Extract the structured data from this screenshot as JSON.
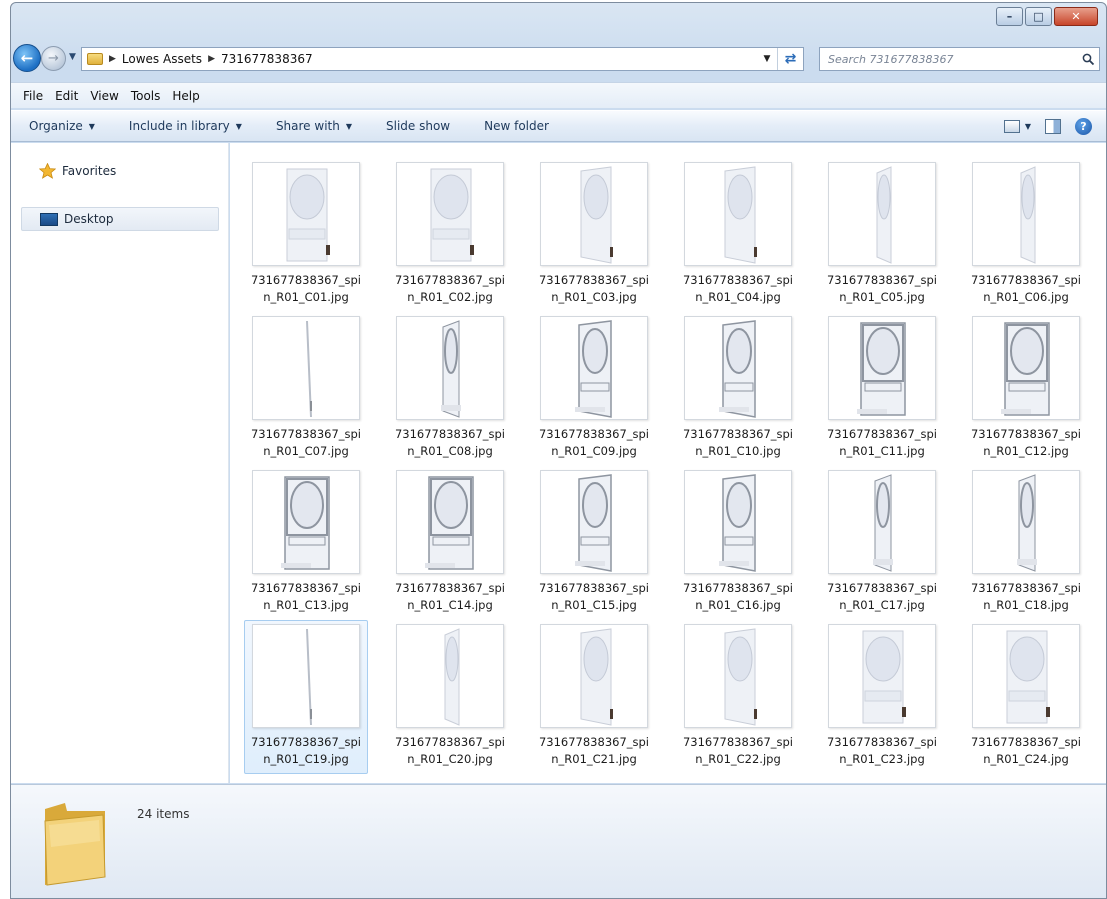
{
  "window": {
    "minimize_glyph": "–",
    "maximize_glyph": "□",
    "close_glyph": "✕"
  },
  "address": {
    "crumbs": [
      "Lowes Assets",
      "731677838367"
    ],
    "search_placeholder": "Search 731677838367"
  },
  "menu": [
    "File",
    "Edit",
    "View",
    "Tools",
    "Help"
  ],
  "commands": [
    {
      "label": "Organize",
      "dropdown": true
    },
    {
      "label": "Include in library",
      "dropdown": true
    },
    {
      "label": "Share with",
      "dropdown": true
    },
    {
      "label": "Slide show",
      "dropdown": false
    },
    {
      "label": "New folder",
      "dropdown": false
    }
  ],
  "nav": {
    "favorites": "Favorites",
    "desktop": "Desktop"
  },
  "files": [
    {
      "line1": "731677838367_spi",
      "line2": "n_R01_C01.jpg",
      "view": "front"
    },
    {
      "line1": "731677838367_spi",
      "line2": "n_R01_C02.jpg",
      "view": "front"
    },
    {
      "line1": "731677838367_spi",
      "line2": "n_R01_C03.jpg",
      "view": "angled"
    },
    {
      "line1": "731677838367_spi",
      "line2": "n_R01_C04.jpg",
      "view": "angled"
    },
    {
      "line1": "731677838367_spi",
      "line2": "n_R01_C05.jpg",
      "view": "side"
    },
    {
      "line1": "731677838367_spi",
      "line2": "n_R01_C06.jpg",
      "view": "side"
    },
    {
      "line1": "731677838367_spi",
      "line2": "n_R01_C07.jpg",
      "view": "edge"
    },
    {
      "line1": "731677838367_spi",
      "line2": "n_R01_C08.jpg",
      "view": "side-back"
    },
    {
      "line1": "731677838367_spi",
      "line2": "n_R01_C09.jpg",
      "view": "angled-back"
    },
    {
      "line1": "731677838367_spi",
      "line2": "n_R01_C10.jpg",
      "view": "angled-back"
    },
    {
      "line1": "731677838367_spi",
      "line2": "n_R01_C11.jpg",
      "view": "back"
    },
    {
      "line1": "731677838367_spi",
      "line2": "n_R01_C12.jpg",
      "view": "back"
    },
    {
      "line1": "731677838367_spi",
      "line2": "n_R01_C13.jpg",
      "view": "back"
    },
    {
      "line1": "731677838367_spi",
      "line2": "n_R01_C14.jpg",
      "view": "back"
    },
    {
      "line1": "731677838367_spi",
      "line2": "n_R01_C15.jpg",
      "view": "angled-back"
    },
    {
      "line1": "731677838367_spi",
      "line2": "n_R01_C16.jpg",
      "view": "angled-back"
    },
    {
      "line1": "731677838367_spi",
      "line2": "n_R01_C17.jpg",
      "view": "side-back"
    },
    {
      "line1": "731677838367_spi",
      "line2": "n_R01_C18.jpg",
      "view": "side-back"
    },
    {
      "line1": "731677838367_spi",
      "line2": "n_R01_C19.jpg",
      "view": "edge",
      "selected": true
    },
    {
      "line1": "731677838367_spi",
      "line2": "n_R01_C20.jpg",
      "view": "side"
    },
    {
      "line1": "731677838367_spi",
      "line2": "n_R01_C21.jpg",
      "view": "angled"
    },
    {
      "line1": "731677838367_spi",
      "line2": "n_R01_C22.jpg",
      "view": "angled"
    },
    {
      "line1": "731677838367_spi",
      "line2": "n_R01_C23.jpg",
      "view": "front"
    },
    {
      "line1": "731677838367_spi",
      "line2": "n_R01_C24.jpg",
      "view": "front"
    }
  ],
  "details": {
    "items_count": "24 items"
  },
  "colors": {
    "accent": "#1d6fc4",
    "door_back_frame": "#8e95a0"
  }
}
